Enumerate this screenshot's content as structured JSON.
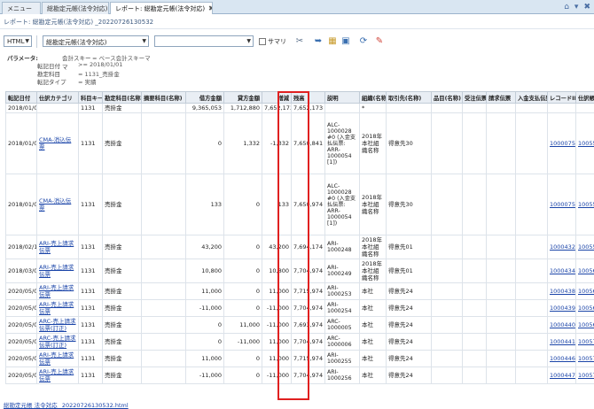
{
  "tabs": [
    {
      "label": "メニュー"
    },
    {
      "label": "総勘定元帳(法令対応)"
    },
    {
      "label": "レポート: 総勘定元帳(法令対応)"
    }
  ],
  "report_title": "レポート: 総勘定元帳(法令対応) _20220726130532",
  "toolbar": {
    "format_value": "HTML",
    "report_select_value": "総勘定元帳(法令対応)",
    "search_value": "",
    "summary_label": "サマリ"
  },
  "params": {
    "heading": "パラメータ:",
    "rows": [
      {
        "key": "会計スキーマ",
        "value": "= ベース会計スキーマ"
      },
      {
        "key": "転記日付",
        "value": ">= 2018/01/01"
      },
      {
        "key": "勘定科目",
        "value": "= 1131_売掛金"
      },
      {
        "key": "転記タイプ",
        "value": "= 実績"
      }
    ]
  },
  "table": {
    "headers": [
      "転記日付",
      "仕訳カテゴリ",
      "科目キー",
      "勘定科目(名称)",
      "摘要科目(名称)",
      "借方金額",
      "貸方金額",
      "増減",
      "残高",
      "説明",
      "組織(名称)",
      "取引先(名称)",
      "品目(名称)",
      "受注伝票",
      "請求伝票",
      "入金支払伝票",
      "レコードID",
      "仕訳帳"
    ],
    "rows": [
      {
        "cls": "r0",
        "date": "2018/01/01",
        "cat": "",
        "key": "1131",
        "acct": "売掛金",
        "sub": "",
        "debit": "9,365,053",
        "credit": "1,712,880",
        "diff": "7,652,173",
        "bal": "7,652,173",
        "desc": "",
        "org": "*",
        "bp": "",
        "prod": "",
        "so": "",
        "inv": "",
        "pay": "",
        "rec": "",
        "jnl": ""
      },
      {
        "cls": "rbig",
        "date": "2018/01/08",
        "cat": "CMA-消込伝票",
        "key": "1131",
        "acct": "売掛金",
        "sub": "",
        "debit": "0",
        "credit": "1,332",
        "diff": "-1,332",
        "bal": "7,650,841",
        "desc": "ALC-1000028 #0 (入金支払伝票: ARR-1000054 [1])",
        "org": "2018年本社組織名称",
        "bp": "得意先30",
        "prod": "",
        "so": "",
        "inv": "",
        "pay": "",
        "rec": "1000075",
        "jnl": "1005585"
      },
      {
        "cls": "rbig",
        "date": "2018/01/08",
        "cat": "CMA-消込伝票",
        "key": "1131",
        "acct": "売掛金",
        "sub": "",
        "debit": "133",
        "credit": "0",
        "diff": "133",
        "bal": "7,650,974",
        "desc": "ALC-1000028 #0 (入金支払伝票: ARR-1000054 [1])",
        "org": "2018年本社組織名称",
        "bp": "得意先30",
        "prod": "",
        "so": "",
        "inv": "",
        "pay": "",
        "rec": "1000075",
        "jnl": "1005587"
      },
      {
        "cls": "rmid",
        "date": "2018/02/12",
        "cat": "ARI-売上請求伝票",
        "key": "1131",
        "acct": "売掛金",
        "sub": "",
        "debit": "43,200",
        "credit": "0",
        "diff": "43,200",
        "bal": "7,694,174",
        "desc": "ARI-1000248",
        "org": "2018年本社組織名称",
        "bp": "得意先01",
        "prod": "",
        "so": "",
        "inv": "",
        "pay": "",
        "rec": "1000432",
        "jnl": "1005593"
      },
      {
        "cls": "rmid",
        "date": "2018/03/08",
        "cat": "ARI-売上請求伝票",
        "key": "1131",
        "acct": "売掛金",
        "sub": "",
        "debit": "10,800",
        "credit": "0",
        "diff": "10,800",
        "bal": "7,704,974",
        "desc": "ARI-1000249",
        "org": "2018年本社組織名称",
        "bp": "得意先01",
        "prod": "",
        "so": "",
        "inv": "",
        "pay": "",
        "rec": "1000434",
        "jnl": "1005670"
      },
      {
        "cls": "rsm",
        "date": "2020/05/08",
        "cat": "ARI-売上請求伝票",
        "key": "1131",
        "acct": "売掛金",
        "sub": "",
        "debit": "11,000",
        "credit": "0",
        "diff": "11,000",
        "bal": "7,715,974",
        "desc": "ARI-1000253",
        "org": "本社",
        "bp": "得意先24",
        "prod": "",
        "so": "",
        "inv": "",
        "pay": "",
        "rec": "1000438",
        "jnl": "1005693"
      },
      {
        "cls": "rsm",
        "date": "2020/05/08",
        "cat": "ARI-売上請求伝票",
        "key": "1131",
        "acct": "売掛金",
        "sub": "",
        "debit": "-11,000",
        "credit": "0",
        "diff": "-11,000",
        "bal": "7,704,974",
        "desc": "ARI-1000254",
        "org": "本社",
        "bp": "得意先24",
        "prod": "",
        "so": "",
        "inv": "",
        "pay": "",
        "rec": "1000439",
        "jnl": "1005696"
      },
      {
        "cls": "rsm",
        "date": "2020/05/08",
        "cat": "ARC-売上請求伝票(訂正)",
        "key": "1131",
        "acct": "売掛金",
        "sub": "",
        "debit": "0",
        "credit": "11,000",
        "diff": "-11,000",
        "bal": "7,693,974",
        "desc": "ARC-1000005",
        "org": "本社",
        "bp": "得意先24",
        "prod": "",
        "so": "",
        "inv": "",
        "pay": "",
        "rec": "1000440",
        "jnl": "1005699"
      },
      {
        "cls": "rsm",
        "date": "2020/05/08",
        "cat": "ARC-売上請求伝票(訂正)",
        "key": "1131",
        "acct": "売掛金",
        "sub": "",
        "debit": "0",
        "credit": "-11,000",
        "diff": "11,000",
        "bal": "7,704,974",
        "desc": "ARC-1000006",
        "org": "本社",
        "bp": "得意先24",
        "prod": "",
        "so": "",
        "inv": "",
        "pay": "",
        "rec": "1000441",
        "jnl": "1005702"
      },
      {
        "cls": "rsm",
        "date": "2020/05/09",
        "cat": "ARI-売上請求伝票",
        "key": "1131",
        "acct": "売掛金",
        "sub": "",
        "debit": "11,000",
        "credit": "0",
        "diff": "11,000",
        "bal": "7,715,974",
        "desc": "ARI-1000255",
        "org": "本社",
        "bp": "得意先24",
        "prod": "",
        "so": "",
        "inv": "",
        "pay": "",
        "rec": "1000446",
        "jnl": "1005717"
      },
      {
        "cls": "rsm",
        "date": "2020/05/09",
        "cat": "ARI-売上請求伝票",
        "key": "1131",
        "acct": "売掛金",
        "sub": "",
        "debit": "-11,000",
        "credit": "0",
        "diff": "-11,000",
        "bal": "7,704,974",
        "desc": "ARI-1000256",
        "org": "本社",
        "bp": "得意先24",
        "prod": "",
        "so": "",
        "inv": "",
        "pay": "",
        "rec": "1000447",
        "jnl": "1005720"
      }
    ]
  },
  "footer_link": "総勘定元帳 法令対応 _20220726130532.html",
  "colors": {
    "highlight": "#e02020",
    "link": "#1a44a8",
    "tabbar": "#d9e6f2"
  },
  "icons": [
    "home-icon",
    "minimize-icon",
    "close-window-icon",
    "export-icon",
    "search-icon",
    "back-icon",
    "archive-icon",
    "attachment-icon",
    "refresh-icon",
    "user-icon"
  ]
}
